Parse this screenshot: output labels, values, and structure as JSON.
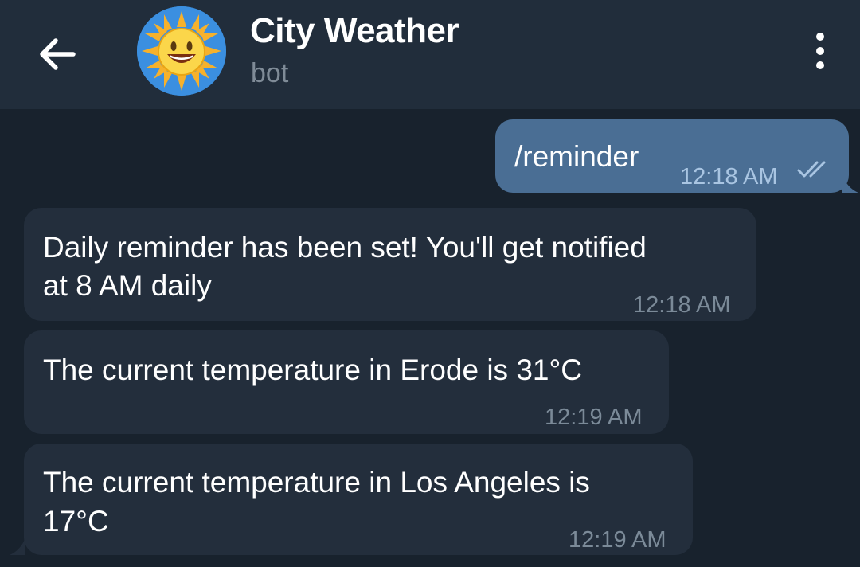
{
  "header": {
    "title": "City Weather",
    "subtitle": "bot",
    "back_icon": "arrow-left-icon",
    "avatar_icon": "sun-emoji-avatar",
    "menu_icon": "more-vertical-icon"
  },
  "messages": [
    {
      "direction": "outgoing",
      "lines": [
        "/reminder"
      ],
      "time": "12:18 AM",
      "status": "read"
    },
    {
      "direction": "incoming",
      "lines": [
        "Daily reminder has been set! You'll get notified",
        "at 8 AM daily"
      ],
      "time": "12:18 AM"
    },
    {
      "direction": "incoming",
      "lines": [
        "The current temperature in Erode is 31°C"
      ],
      "time": "12:19 AM"
    },
    {
      "direction": "incoming",
      "lines": [
        "The current temperature in Los Angeles is",
        "17°C"
      ],
      "time": "12:19 AM"
    }
  ],
  "colors": {
    "background": "#18222d",
    "header": "#212d3b",
    "incoming_bubble": "#232e3c",
    "outgoing_bubble": "#4a6e94",
    "read_checks": "#a9c5e2"
  }
}
